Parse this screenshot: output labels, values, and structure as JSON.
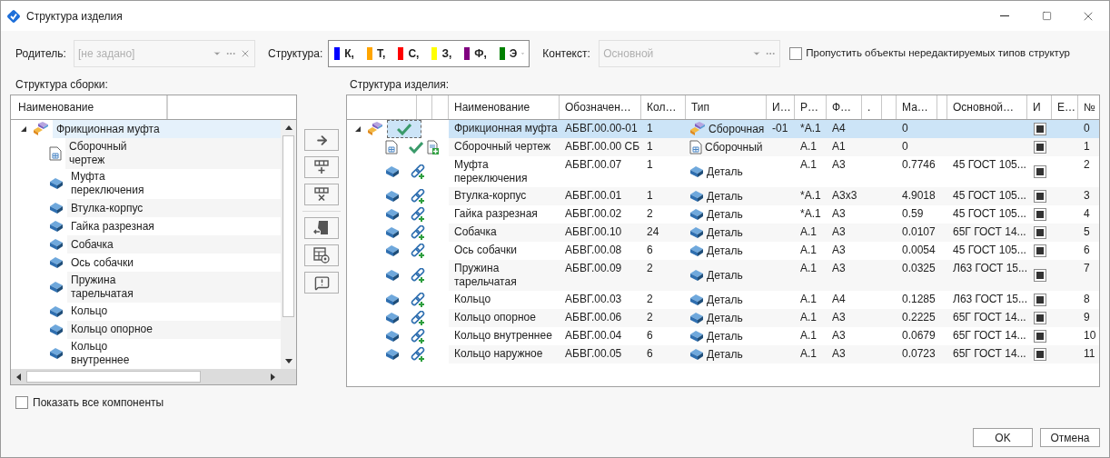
{
  "window": {
    "title": "Структура изделия"
  },
  "parent": {
    "label": "Родитель:",
    "placeholder": "[не задано]",
    "disabled": true
  },
  "structure": {
    "label": "Структура:",
    "items": [
      {
        "label": "К,",
        "color": "#0000ff"
      },
      {
        "label": "Т,",
        "color": "#ffa500"
      },
      {
        "label": "С,",
        "color": "#ff0000"
      },
      {
        "label": "З,",
        "color": "#ffff00"
      },
      {
        "label": "Ф,",
        "color": "#800080"
      },
      {
        "label": "Э",
        "color": "#008000"
      }
    ]
  },
  "context": {
    "label": "Контекст:",
    "value": "Основной",
    "disabled": true
  },
  "skip_option": {
    "label": "Пропустить объекты нередактируемых типов структур",
    "checked": false
  },
  "assembly_panel": {
    "title": "Структура сборки:",
    "columns": [
      "Наименование"
    ],
    "tree": [
      {
        "name": "Фрикционная муфта",
        "kind": "assembly",
        "expanded": true,
        "selected": true,
        "children": [
          {
            "name": "Сборочный чертеж",
            "kind": "drawing",
            "selected": false
          },
          {
            "name": "Муфта переключения",
            "kind": "part",
            "selected": false
          },
          {
            "name": "Втулка-корпус",
            "kind": "part",
            "selected": false
          },
          {
            "name": "Гайка разрезная",
            "kind": "part",
            "selected": false
          },
          {
            "name": "Собачка",
            "kind": "part",
            "selected": false
          },
          {
            "name": "Ось собачки",
            "kind": "part",
            "selected": false
          },
          {
            "name": "Пружина тарельчатая",
            "kind": "part",
            "selected": false
          },
          {
            "name": "Кольцо",
            "kind": "part",
            "selected": false
          },
          {
            "name": "Кольцо опорное",
            "kind": "part",
            "selected": false
          },
          {
            "name": "Кольцо внутреннее",
            "kind": "part",
            "selected": false
          }
        ]
      }
    ]
  },
  "show_all": {
    "label": "Показать все компоненты",
    "checked": false
  },
  "product_panel": {
    "title": "Структура изделия:",
    "columns": [
      {
        "kind": "blank"
      },
      {
        "kind": "blank"
      },
      {
        "kind": "blank"
      },
      {
        "kind": "text",
        "label": "Наименование"
      },
      {
        "kind": "text",
        "label": "Обозначен…"
      },
      {
        "kind": "text",
        "label": "Кол…"
      },
      {
        "kind": "text",
        "label": "Тип"
      },
      {
        "kind": "text",
        "label": "И…"
      },
      {
        "kind": "text",
        "label": "Р…"
      },
      {
        "kind": "text",
        "label": "Ф…"
      },
      {
        "kind": "text",
        "label": "."
      },
      {
        "kind": "blank"
      },
      {
        "kind": "text",
        "label": "Ма…"
      },
      {
        "kind": "blank"
      },
      {
        "kind": "text",
        "label": "Основной…"
      },
      {
        "kind": "text",
        "label": "И"
      },
      {
        "kind": "text",
        "label": "Е…"
      },
      {
        "kind": "text",
        "label": "№"
      }
    ],
    "rows": [
      {
        "kind": "assembly",
        "selected": true,
        "expanded": true,
        "name": "Фрикционная муфта",
        "designation": "АБВГ.00.00-01",
        "quantity": "1",
        "type": "Сборочная",
        "column_8": "-01",
        "column_9": "*А.1",
        "column_10": "А4",
        "column_13": "0",
        "checked": true,
        "number": "0",
        "children": [
          {
            "kind": "drawing",
            "selected": false,
            "name": "Сборочный чертеж",
            "designation": "АБВГ.00.00 СБ",
            "quantity": "1",
            "type": "Сборочный",
            "column_9": "А.1",
            "column_10": "А1",
            "column_13": "0",
            "checked": true,
            "number": "1"
          },
          {
            "kind": "part",
            "selected": false,
            "name": "Муфта переключения",
            "designation": "АБВГ.00.07",
            "quantity": "1",
            "type": "Деталь",
            "column_9": "А.1",
            "column_10": "А3",
            "column_13": "0.7746",
            "column_15": "45 ГОСТ 105...",
            "checked": true,
            "number": "2"
          },
          {
            "kind": "part",
            "selected": false,
            "name": "Втулка-корпус",
            "designation": "АБВГ.00.01",
            "quantity": "1",
            "type": "Деталь",
            "column_9": "*А.1",
            "column_10": "А3х3",
            "column_13": "4.9018",
            "column_15": "45 ГОСТ 105...",
            "checked": true,
            "number": "3"
          },
          {
            "kind": "part",
            "selected": false,
            "name": "Гайка разрезная",
            "designation": "АБВГ.00.02",
            "quantity": "2",
            "type": "Деталь",
            "column_9": "*А.1",
            "column_10": "А3",
            "column_13": "0.59",
            "column_15": "45 ГОСТ 105...",
            "checked": true,
            "number": "4"
          },
          {
            "kind": "part",
            "selected": false,
            "name": "Собачка",
            "designation": "АБВГ.00.10",
            "quantity": "24",
            "type": "Деталь",
            "column_9": "А.1",
            "column_10": "А3",
            "column_13": "0.0107",
            "column_15": "65Г ГОСТ 14...",
            "checked": true,
            "number": "5"
          },
          {
            "kind": "part",
            "selected": false,
            "name": "Ось собачки",
            "designation": "АБВГ.00.08",
            "quantity": "6",
            "type": "Деталь",
            "column_9": "А.1",
            "column_10": "А3",
            "column_13": "0.0054",
            "column_15": "45 ГОСТ 105...",
            "checked": true,
            "number": "6"
          },
          {
            "kind": "part",
            "selected": false,
            "name": "Пружина тарельчатая",
            "designation": "АБВГ.00.09",
            "quantity": "2",
            "type": "Деталь",
            "column_9": "А.1",
            "column_10": "А3",
            "column_13": "0.0325",
            "column_15": "Л63 ГОСТ 15...",
            "checked": true,
            "number": "7"
          },
          {
            "kind": "part",
            "selected": false,
            "name": "Кольцо",
            "designation": "АБВГ.00.03",
            "quantity": "2",
            "type": "Деталь",
            "column_9": "А.1",
            "column_10": "А4",
            "column_13": "0.1285",
            "column_15": "Л63 ГОСТ 15...",
            "checked": true,
            "number": "8"
          },
          {
            "kind": "part",
            "selected": false,
            "name": "Кольцо опорное",
            "designation": "АБВГ.00.06",
            "quantity": "2",
            "type": "Деталь",
            "column_9": "А.1",
            "column_10": "А3",
            "column_13": "0.2225",
            "column_15": "65Г ГОСТ 14...",
            "checked": true,
            "number": "9"
          },
          {
            "kind": "part",
            "selected": false,
            "name": "Кольцо внутреннее",
            "designation": "АБВГ.00.04",
            "quantity": "6",
            "type": "Деталь",
            "column_9": "А.1",
            "column_10": "А3",
            "column_13": "0.0679",
            "column_15": "65Г ГОСТ 14...",
            "checked": true,
            "number": "10"
          },
          {
            "kind": "part",
            "selected": false,
            "name": "Кольцо наружное",
            "designation": "АБВГ.00.05",
            "quantity": "6",
            "type": "Деталь",
            "column_9": "А.1",
            "column_10": "А3",
            "column_13": "0.0723",
            "column_15": "65Г ГОСТ 14...",
            "checked": true,
            "number": "11"
          }
        ]
      }
    ]
  },
  "buttons": [
    {
      "label": "OK"
    },
    {
      "label": "Отмена"
    }
  ]
}
